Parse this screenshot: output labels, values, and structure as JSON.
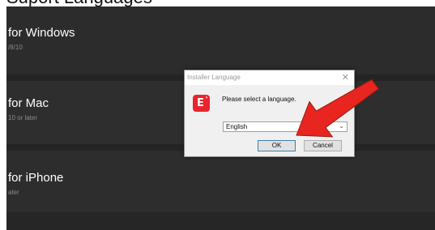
{
  "page_top_fragment": "Suport Languages",
  "platforms": [
    {
      "title": "for Windows",
      "subtitle": "/8/10"
    },
    {
      "title": "for Mac",
      "subtitle": "10 or later"
    },
    {
      "title": "for iPhone",
      "subtitle": "ater"
    }
  ],
  "dialog": {
    "title": "Installer Language",
    "close_icon": "close-icon",
    "app_icon": "eshare-app-icon",
    "prompt": "Please select a language.",
    "language_selected": "English",
    "ok_label": "OK",
    "cancel_label": "Cancel"
  },
  "annotation": {
    "arrow_color": "#e8251f"
  }
}
